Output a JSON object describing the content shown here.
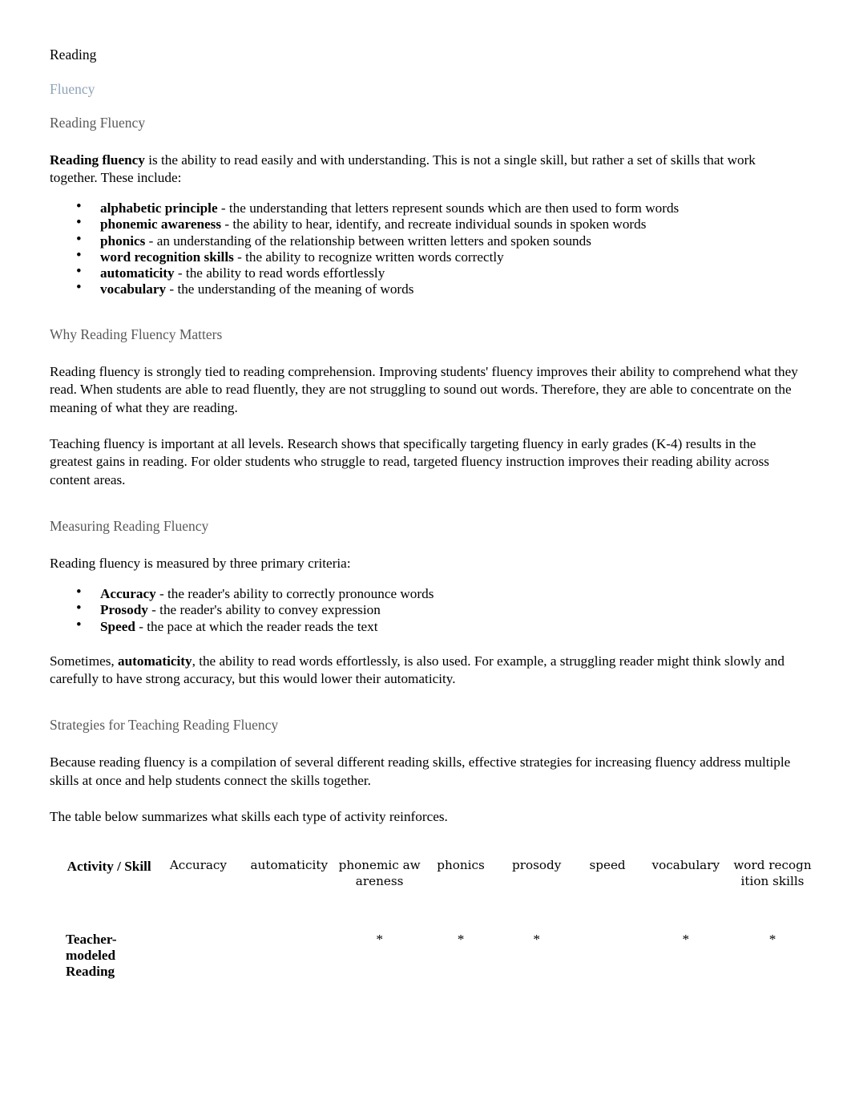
{
  "document": {
    "title": "Reading",
    "subtitle": "Fluency",
    "heading_main": "Reading Fluency"
  },
  "intro": {
    "lead_bold": "Reading fluency",
    "lead_rest": " is the ability to read easily and with understanding. This is not a single skill, but rather a set of skills that work together. These include:"
  },
  "skills_list": [
    {
      "term": "alphabetic principle",
      "definition": " - the understanding that letters represent sounds which are then used to form words"
    },
    {
      "term": "phonemic awareness",
      "definition": " - the ability to hear, identify, and recreate individual sounds in spoken words"
    },
    {
      "term": "phonics",
      "definition": " - an understanding of the relationship between written letters and spoken sounds"
    },
    {
      "term": "word recognition skills",
      "definition": " - the ability to recognize written words correctly"
    },
    {
      "term": "automaticity",
      "definition": " - the ability to read words effortlessly"
    },
    {
      "term": "vocabulary",
      "definition": " - the understanding of the meaning of words"
    }
  ],
  "why_section": {
    "heading": "Why Reading Fluency Matters",
    "paragraph1": "Reading fluency is strongly tied to reading comprehension. Improving students' fluency improves their ability to comprehend what they read. When students are able to read fluently, they are not struggling to sound out words. Therefore, they are able to concentrate on the meaning of what they are reading.",
    "paragraph2": "Teaching fluency is important at all levels. Research shows that specifically targeting fluency in early grades (K-4) results in the greatest gains in reading. For older students who struggle to read, targeted fluency instruction improves their reading ability across content areas."
  },
  "measuring_section": {
    "heading": "Measuring Reading Fluency",
    "intro": "Reading fluency is measured by three primary criteria:",
    "criteria": [
      {
        "term": "Accuracy",
        "definition": " - the reader's ability to correctly pronounce words"
      },
      {
        "term": "Prosody",
        "definition": " - the reader's ability to convey expression"
      },
      {
        "term": "Speed",
        "definition": " - the pace at which the reader reads the text"
      }
    ],
    "note_part1": "Sometimes, ",
    "note_bold": "automaticity",
    "note_part2": ", the ability to read words effortlessly, is also used. For example, a struggling reader might think slowly and carefully to have strong accuracy, but this would lower their automaticity."
  },
  "strategies_section": {
    "heading": "Strategies for Teaching Reading Fluency",
    "paragraph1": "Because reading fluency is a compilation of several different reading skills, effective strategies for increasing fluency address multiple skills at once and help students connect the skills together.",
    "paragraph2": "The table below summarizes what skills each type of activity reinforces."
  },
  "table": {
    "columns": [
      "Activity / Skill",
      "Accuracy",
      "automaticity",
      "phonemic awareness",
      "phonics",
      "prosody",
      "speed",
      "vocabulary",
      "word recognition skills"
    ],
    "mark_symbol": "*",
    "rows": [
      {
        "activity": "Teacher-modeled Reading",
        "accuracy": "",
        "automaticity": "",
        "phonemic_awareness": "*",
        "phonics": "*",
        "prosody": "*",
        "speed": "",
        "vocabulary": "*",
        "word_recognition_skills": "*"
      }
    ]
  }
}
